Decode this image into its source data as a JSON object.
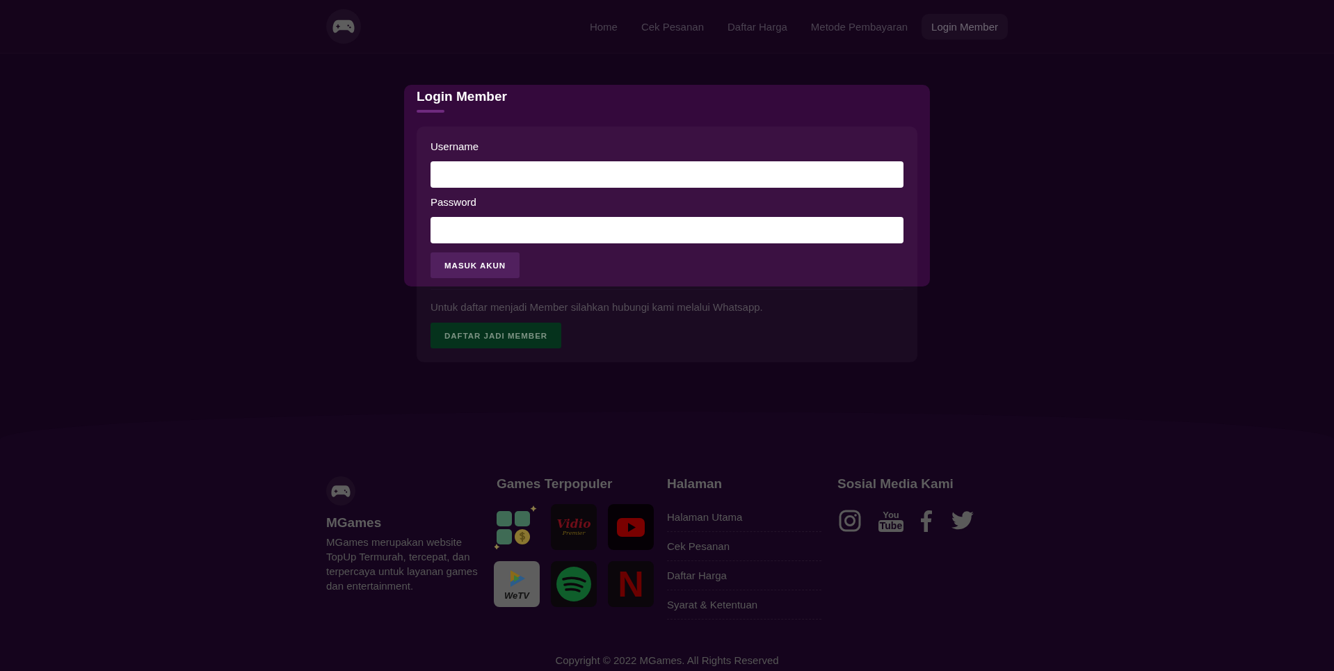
{
  "nav": {
    "items": [
      {
        "label": "Home",
        "selected": false
      },
      {
        "label": "Cek Pesanan",
        "selected": false
      },
      {
        "label": "Daftar Harga",
        "selected": false
      },
      {
        "label": "Metode Pembayaran",
        "selected": false
      },
      {
        "label": "Login Member",
        "selected": true
      }
    ]
  },
  "login": {
    "title": "Login Member",
    "fields": [
      {
        "label": "Username"
      },
      {
        "label": "Password"
      }
    ],
    "submit": "MASUK AKUN",
    "note": "Untuk daftar menjadi Member silahkan hubungi kami melalui Whatsapp.",
    "register_button": "DAFTAR JADI MEMBER"
  },
  "footer": {
    "brand": {
      "name": "MGames",
      "description": "MGames merupakan website TopUp Termurah, tercepat, dan terpercaya untuk layanan games dan entertainment."
    },
    "games": {
      "title": "Games Terpopuler",
      "items": [
        {
          "kind": "coins"
        },
        {
          "kind": "vidio",
          "label": "Vidio",
          "sublabel": "Premier"
        },
        {
          "kind": "play"
        },
        {
          "kind": "wetv",
          "label": "WeTV"
        },
        {
          "kind": "spotify"
        },
        {
          "kind": "netflix",
          "label": "N"
        }
      ]
    },
    "pages": {
      "title": "Halaman",
      "links": [
        "Halaman Utama",
        "Cek Pesanan",
        "Daftar Harga",
        "Syarat & Ketentuan"
      ]
    },
    "social": {
      "title": "Sosial Media Kami",
      "items": [
        {
          "kind": "instagram"
        },
        {
          "kind": "youtube",
          "label": "You",
          "sublabel": "Tube"
        },
        {
          "kind": "facebook"
        },
        {
          "kind": "twitter"
        }
      ]
    },
    "copyright": "Copyright © 2022 MGames. All Rights Reserved"
  }
}
